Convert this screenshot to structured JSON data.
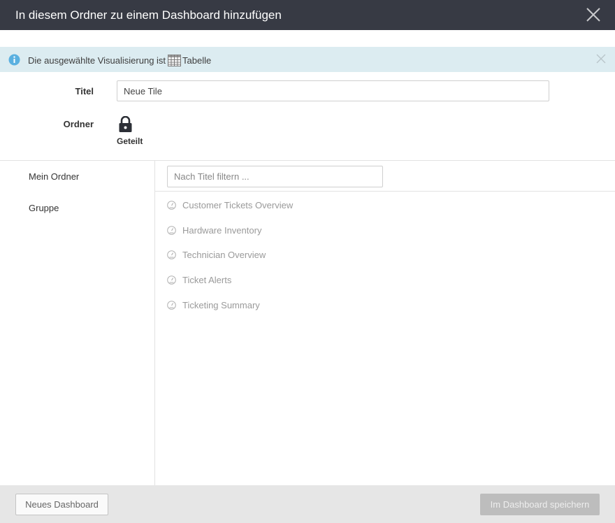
{
  "dialog": {
    "title": "In diesem Ordner zu einem Dashboard hinzufügen",
    "close_icon": "close-icon"
  },
  "info": {
    "message": "Die ausgewählte Visualisierung ist",
    "visualization": "Tabelle",
    "info_icon": "info-circle-icon",
    "table_icon": "table-icon",
    "dismiss_icon": "close-icon",
    "background_color": "#dcecf1",
    "icon_color": "#5ab0e0"
  },
  "form": {
    "title_label": "Titel",
    "title_value": "Neue Tile",
    "folder_label": "Ordner",
    "folder_icon": "lock-icon",
    "folder_value": "Geteilt"
  },
  "sidebar": {
    "items": [
      {
        "label": "Mein Ordner"
      },
      {
        "label": "Gruppe"
      }
    ]
  },
  "list": {
    "filter_placeholder": "Nach Titel filtern ...",
    "item_icon": "dashboard-gauge-icon",
    "items": [
      {
        "label": "Customer Tickets Overview"
      },
      {
        "label": "Hardware Inventory"
      },
      {
        "label": "Technician Overview"
      },
      {
        "label": "Ticket Alerts"
      },
      {
        "label": "Ticketing Summary"
      }
    ]
  },
  "footer": {
    "new_dashboard_label": "Neues Dashboard",
    "save_label": "Im Dashboard speichern"
  },
  "colors": {
    "titlebar": "#373a44",
    "footer": "#e6e6e6",
    "save_button_disabled": "#bdbdbd"
  }
}
